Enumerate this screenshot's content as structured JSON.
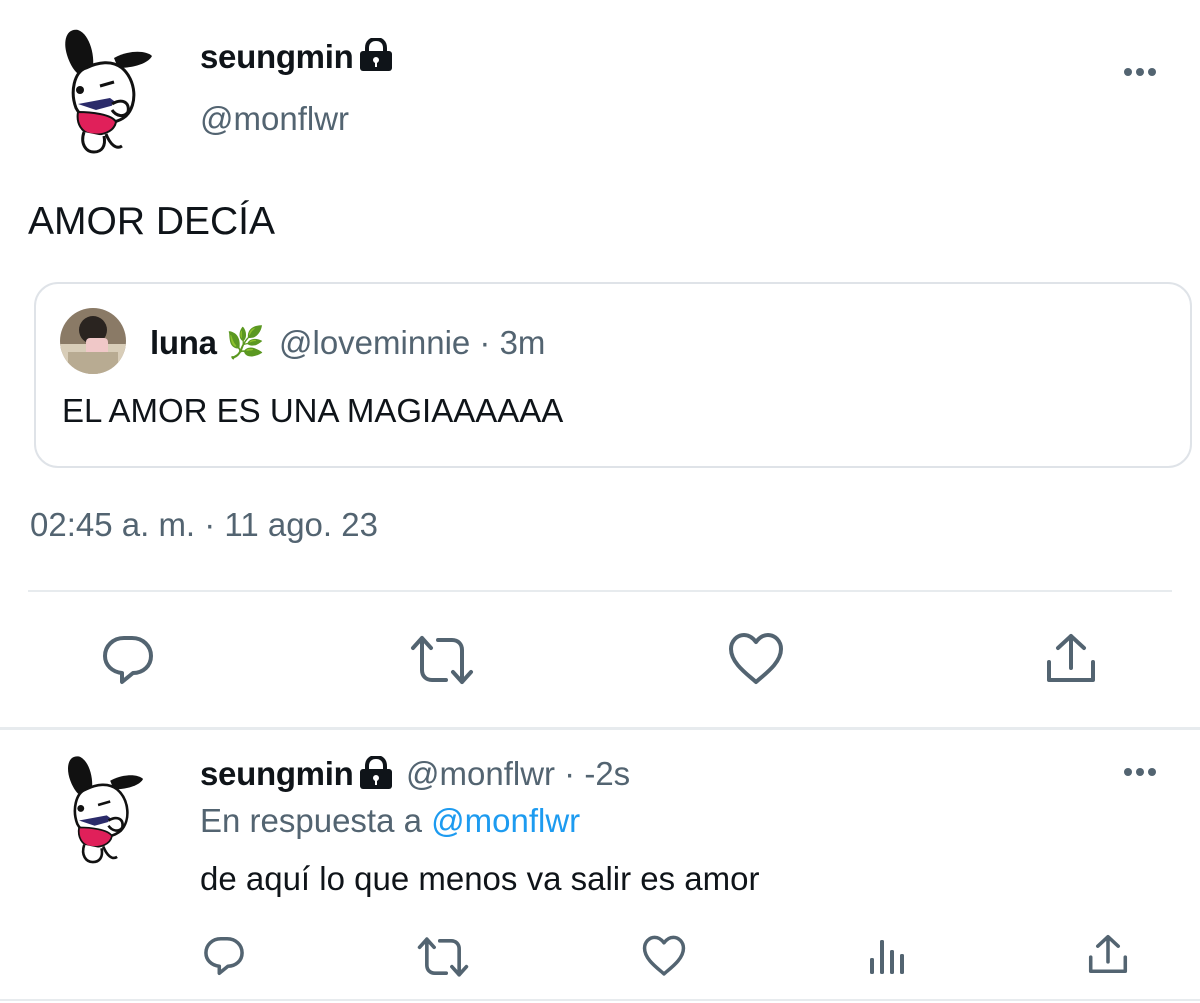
{
  "main_tweet": {
    "author_name": "seungmin",
    "author_handle": "@monflwr",
    "text": "AMOR DECÍA",
    "quoted": {
      "author_name": "luna",
      "author_emoji": "🌿",
      "handle_time": "@loveminnie · 3m",
      "text": "EL AMOR ES UNA MAGIAAAAAA"
    },
    "timestamp": "02:45 a. m. · 11 ago. 23"
  },
  "reply": {
    "author_name": "seungmin",
    "handle_time": "@monflwr · -2s",
    "replying_prefix": "En respuesta a",
    "replying_to": "@monflwr",
    "text": "de aquí lo que menos va salir es amor"
  },
  "icons": {
    "lock": "lock-icon",
    "more": "more-icon",
    "reply": "reply-icon",
    "retweet": "retweet-icon",
    "like": "heart-icon",
    "share": "share-icon",
    "views": "views-icon"
  },
  "colors": {
    "text": "#0f1419",
    "secondary": "#536471",
    "link": "#1d9bf0",
    "border": "#dfe3e8",
    "avatar_shirt": "#e0205a"
  }
}
